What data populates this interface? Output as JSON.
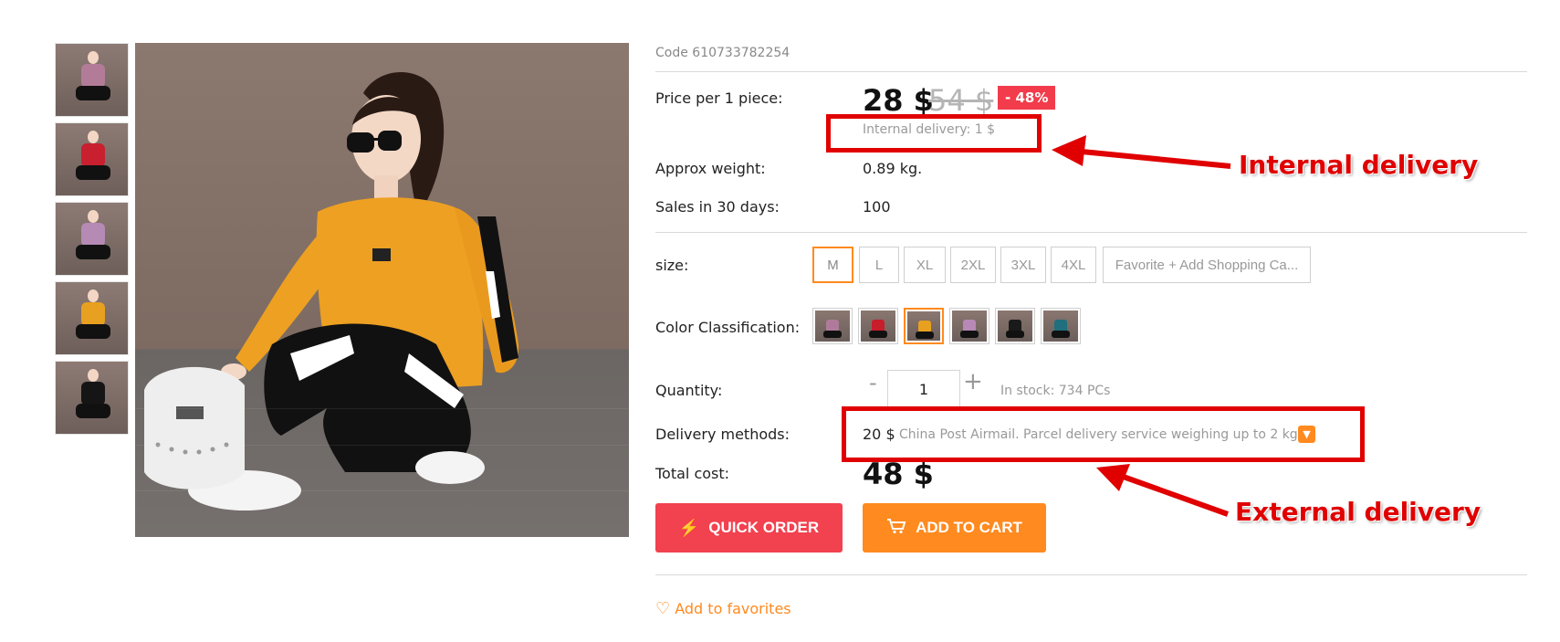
{
  "product": {
    "code": "Code 610733782254",
    "price_label": "Price per 1 piece:",
    "price": "28 $",
    "old_price": "54 $",
    "discount": "- 48%",
    "internal_delivery": "Internal delivery: 1 $",
    "weight_label": "Approx weight:",
    "weight_value": "0.89 kg.",
    "sales_label": "Sales in 30 days:",
    "sales_value": "100",
    "size_label": "size:",
    "sizes": [
      "M",
      "L",
      "XL",
      "2XL",
      "3XL",
      "4XL",
      "Favorite + Add Shopping Ca..."
    ],
    "selected_size": "M",
    "color_label": "Color Classification:",
    "quantity_label": "Quantity:",
    "quantity_minus": "-",
    "quantity_value": "1",
    "quantity_plus": "+",
    "in_stock": "In stock: 734 PCs",
    "delivery_label": "Delivery methods:",
    "delivery_price": "20 $",
    "delivery_desc": "China Post Airmail. Parcel delivery service weighing up to 2 kg.",
    "total_label": "Total cost:",
    "total_value": "48 $",
    "quick_order_label": "QUICK ORDER",
    "add_to_cart_label": "ADD TO CART",
    "favorites_label": "Add to favorites"
  },
  "annotations": {
    "internal": "Internal delivery",
    "external": "External delivery"
  },
  "colors": {
    "accent_orange": "#ff8a1f",
    "quick_order_red": "#f2414f",
    "discount_red": "#f23c4c",
    "annotation_red": "#e00000",
    "swatches": [
      "#b07a9a",
      "#c81d2b",
      "#e8a020",
      "#b889b6",
      "#1a1a1a",
      "#1f6f7e"
    ],
    "thumbs": [
      "#b27c98",
      "#c8202e",
      "#b58ab5",
      "#e8a020",
      "#151515"
    ]
  },
  "icons": {
    "quick_order": "lightning-icon",
    "cart": "cart-icon",
    "favorite": "heart-icon",
    "dropdown": "chevron-down-icon"
  }
}
